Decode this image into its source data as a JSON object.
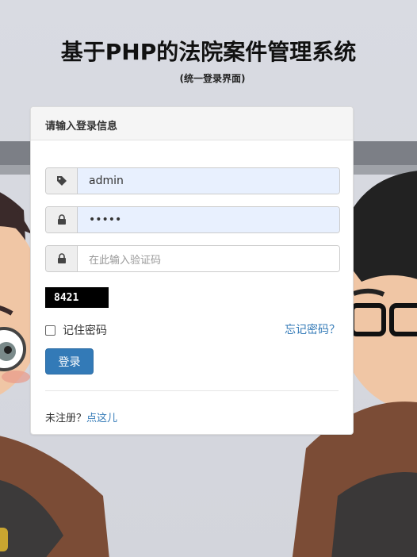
{
  "header": {
    "title": "基于PHP的法院案件管理系统",
    "subtitle": "(统一登录界面)"
  },
  "panel": {
    "heading": "请输入登录信息"
  },
  "form": {
    "username_value": "admin",
    "password_value": "•••••",
    "captcha_placeholder": "在此输入验证码",
    "captcha_code": "8421",
    "remember_label": "记住密码",
    "forgot_label": "忘记密码？",
    "login_label": "登录"
  },
  "footer": {
    "prompt": "未注册？",
    "link": "点这儿"
  },
  "icons": {
    "username": "tag-icon",
    "password": "lock-icon",
    "captcha": "lock-icon"
  },
  "colors": {
    "primary": "#337ab7",
    "autofill": "#e8f0fe"
  }
}
